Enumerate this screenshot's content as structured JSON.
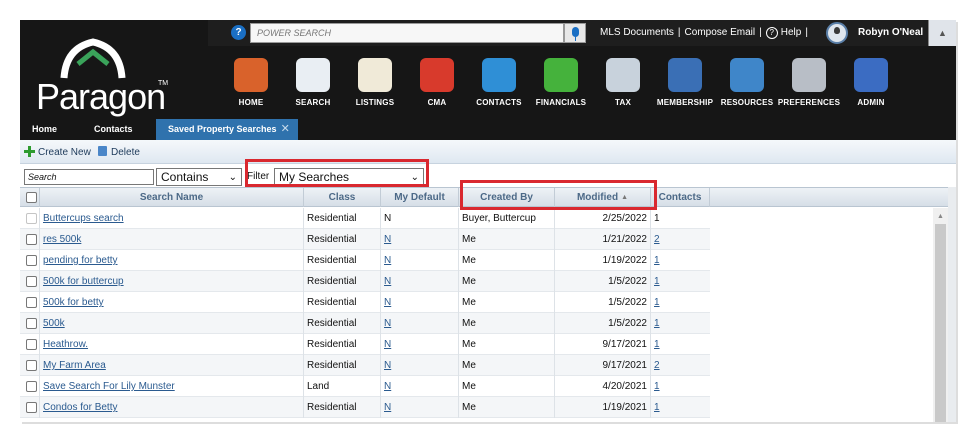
{
  "topbar": {
    "search_placeholder": "POWER SEARCH",
    "links": [
      "MLS Documents",
      "Compose Email",
      "Help"
    ],
    "user_name": "Robyn O'Neal"
  },
  "brand": {
    "logo_text": "Paragon",
    "tm": "TM"
  },
  "nav": [
    {
      "label": "HOME",
      "icon": "home-icon",
      "color": "#d9622b"
    },
    {
      "label": "SEARCH",
      "icon": "search-icon",
      "color": "#e9eef3"
    },
    {
      "label": "LISTINGS",
      "icon": "listings-icon",
      "color": "#f0ead8"
    },
    {
      "label": "CMA",
      "icon": "cma-icon",
      "color": "#d83a2c"
    },
    {
      "label": "CONTACTS",
      "icon": "contacts-icon",
      "color": "#2f8fd6"
    },
    {
      "label": "FINANCIALS",
      "icon": "financials-icon",
      "color": "#45b23c"
    },
    {
      "label": "TAX",
      "icon": "tax-icon",
      "color": "#c8d2dc"
    },
    {
      "label": "MEMBERSHIP",
      "icon": "membership-icon",
      "color": "#3a6fb5"
    },
    {
      "label": "RESOURCES",
      "icon": "resources-icon",
      "color": "#3f86c9"
    },
    {
      "label": "PREFERENCES",
      "icon": "preferences-icon",
      "color": "#b8bec6"
    },
    {
      "label": "ADMIN",
      "icon": "admin-icon",
      "color": "#3b6cc2"
    }
  ],
  "tabs": [
    "Home",
    "Contacts",
    "Saved Property Searches"
  ],
  "toolbar": {
    "create_new": "Create New",
    "delete": "Delete"
  },
  "filter": {
    "search_value": "Search",
    "match_mode": "Contains",
    "filter_label": "Filter",
    "filter_value": "My Searches"
  },
  "columns": [
    "Search Name",
    "Class",
    "My Default",
    "Created By",
    "Modified",
    "Contacts"
  ],
  "rows": [
    {
      "name": "Buttercups search",
      "class": "Residential",
      "default": "N",
      "created_by": "Buyer, Buttercup",
      "modified": "2/25/2022",
      "contacts": "1"
    },
    {
      "name": "res 500k",
      "class": "Residential",
      "default": "N",
      "created_by": "Me",
      "modified": "1/21/2022",
      "contacts": "2"
    },
    {
      "name": "pending for betty",
      "class": "Residential",
      "default": "N",
      "created_by": "Me",
      "modified": "1/19/2022",
      "contacts": "1"
    },
    {
      "name": "500k for buttercup",
      "class": "Residential",
      "default": "N",
      "created_by": "Me",
      "modified": "1/5/2022",
      "contacts": "1"
    },
    {
      "name": "500k for betty",
      "class": "Residential",
      "default": "N",
      "created_by": "Me",
      "modified": "1/5/2022",
      "contacts": "1"
    },
    {
      "name": "500k",
      "class": "Residential",
      "default": "N",
      "created_by": "Me",
      "modified": "1/5/2022",
      "contacts": "1"
    },
    {
      "name": "Heathrow.",
      "class": "Residential",
      "default": "N",
      "created_by": "Me",
      "modified": "9/17/2021",
      "contacts": "1"
    },
    {
      "name": "My Farm Area",
      "class": "Residential",
      "default": "N",
      "created_by": "Me",
      "modified": "9/17/2021",
      "contacts": "2"
    },
    {
      "name": "Save Search For Lily Munster",
      "class": "Land",
      "default": "N",
      "created_by": "Me",
      "modified": "4/20/2021",
      "contacts": "1"
    },
    {
      "name": "Condos for Betty",
      "class": "Residential",
      "default": "N",
      "created_by": "Me",
      "modified": "1/19/2021",
      "contacts": "1"
    }
  ],
  "colors": {
    "header_bg": "#161616",
    "active_tab": "#2f72ad",
    "highlight": "#d9282f",
    "link": "#2a5a8f"
  }
}
